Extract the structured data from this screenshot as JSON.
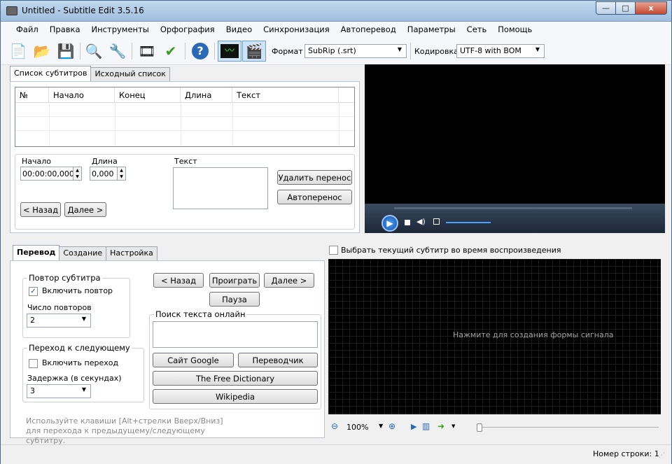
{
  "window": {
    "title": "Untitled - Subtitle Edit 3.5.16",
    "minimize": "—",
    "maximize": "□",
    "close": "x"
  },
  "menu": [
    "Файл",
    "Правка",
    "Инструменты",
    "Орфография",
    "Видео",
    "Синхронизация",
    "Автоперевод",
    "Параметры",
    "Сеть",
    "Помощь"
  ],
  "toolbar": {
    "format_label": "Формат",
    "format_value": "SubRip (.srt)",
    "encoding_label": "Кодировка",
    "encoding_value": "UTF-8 with BOM",
    "icons": {
      "new": "📄",
      "open": "📂",
      "save": "💾",
      "find": "🔍",
      "replace": "🔧",
      "fix": "🎞",
      "spell": "✔",
      "help": "?",
      "waveform": "〰",
      "video": "🎬"
    }
  },
  "subtitle_tabs": [
    "Список субтитров",
    "Исходный список"
  ],
  "grid": {
    "columns": [
      "№",
      "Начало",
      "Конец",
      "Длина",
      "Текст"
    ]
  },
  "editor": {
    "start_label": "Начало",
    "start_value": "00:00:00,000",
    "duration_label": "Длина",
    "duration_value": "0,000",
    "text_label": "Текст",
    "remove_break": "Удалить перенос",
    "auto_break": "Автоперенос",
    "prev": "< Назад",
    "next": "Далее >"
  },
  "bottom_tabs": [
    "Перевод",
    "Создание",
    "Настройка"
  ],
  "translate": {
    "repeat_group": "Повтор субтитра",
    "repeat_enable": "Включить повтор",
    "repeat_checked": true,
    "repeat_count_label": "Число повторов",
    "repeat_count": "2",
    "next_group": "Переход к следующему",
    "next_enable": "Включить переход",
    "next_checked": false,
    "delay_label": "Задержка (в секундах)",
    "delay": "3",
    "btn_back": "< Назад",
    "btn_play": "Проиграть",
    "btn_next": "Далее >",
    "btn_pause": "Пауза",
    "search_group": "Поиск текста онлайн",
    "google": "Сайт Google",
    "translator": "Переводчик",
    "dictionary": "The Free Dictionary",
    "wikipedia": "Wikipedia",
    "hint": "Используйте клавиши [Alt+стрелки Вверх/Вниз] для перехода к предыдущему/следующему субтитру."
  },
  "waveform": {
    "follow_label": "Выбрать текущий субтитр во время воспроизведения",
    "placeholder": "Нажмите для создания формы сигнала",
    "zoom": "100%"
  },
  "status": {
    "line_number": "Номер строки: 1"
  }
}
